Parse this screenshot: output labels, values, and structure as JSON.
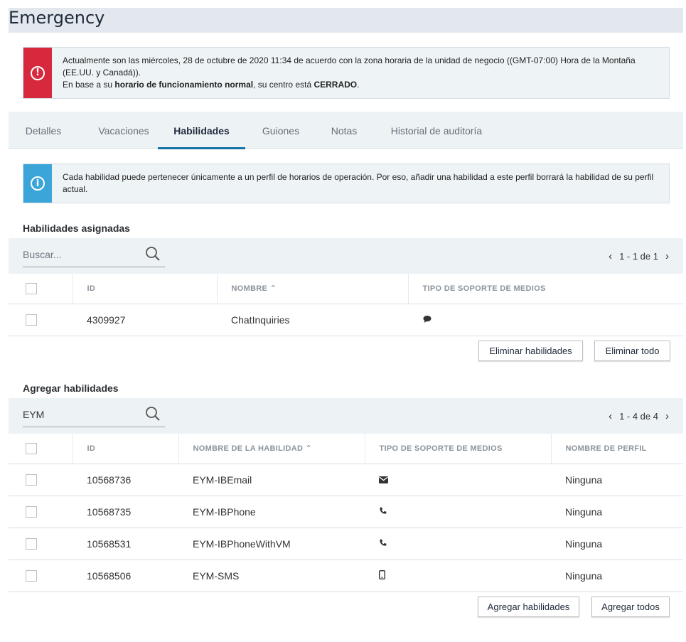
{
  "page": {
    "title": "Emergency"
  },
  "closed_alert": {
    "line1": "Actualmente son las miércoles, 28 de octubre de 2020 11:34 de acuerdo con la zona horaria de la unidad de negocio ((GMT-07:00) Hora de la Montaña (EE.UU. y Canadá)).",
    "line2_prefix": "En base a su ",
    "line2_bold": "horario de funcionamiento normal",
    "line2_mid": ", su centro está ",
    "line2_status": "CERRADO",
    "line2_end": "."
  },
  "tabs": [
    {
      "label": "Detalles"
    },
    {
      "label": "Vacaciones"
    },
    {
      "label": "Habilidades"
    },
    {
      "label": "Guiones"
    },
    {
      "label": "Notas"
    },
    {
      "label": "Historial de auditoría"
    }
  ],
  "info_alert": {
    "text": "Cada habilidad puede pertenecer únicamente a un perfil de horarios de operación. Por eso, añadir una habilidad a este perfil borrará la habilidad de su perfil actual."
  },
  "assigned": {
    "title": "Habilidades asignadas",
    "search_placeholder": "Buscar...",
    "search_value": "",
    "pager": "1 - 1 de 1",
    "columns": {
      "id": "ID",
      "name": "NOMBRE",
      "media": "TIPO DE SOPORTE DE MEDIOS"
    },
    "rows": [
      {
        "id": "4309927",
        "name": "ChatInquiries",
        "media": "chat-icon"
      }
    ],
    "buttons": {
      "remove": "Eliminar habilidades",
      "remove_all": "Eliminar todo"
    }
  },
  "add": {
    "title": "Agregar habilidades",
    "search_value": "EYM",
    "pager": "1 - 4 de 4",
    "columns": {
      "id": "ID",
      "name": "NOMBRE DE LA HABILIDAD",
      "media": "TIPO DE SOPORTE DE MEDIOS",
      "profile": "NOMBRE DE PERFIL"
    },
    "rows": [
      {
        "id": "10568736",
        "name": "EYM-IBEmail",
        "media": "email-icon",
        "profile": "Ninguna"
      },
      {
        "id": "10568735",
        "name": "EYM-IBPhone",
        "media": "phone-icon",
        "profile": "Ninguna"
      },
      {
        "id": "10568531",
        "name": "EYM-IBPhoneWithVM",
        "media": "phone-icon",
        "profile": "Ninguna"
      },
      {
        "id": "10568506",
        "name": "EYM-SMS",
        "media": "mobile-icon",
        "profile": "Ninguna"
      }
    ],
    "buttons": {
      "add": "Agregar habilidades",
      "add_all": "Agregar todos"
    }
  },
  "colors": {
    "error": "#d6293e",
    "info": "#3ba5d9",
    "tab_active": "#1672a8"
  }
}
